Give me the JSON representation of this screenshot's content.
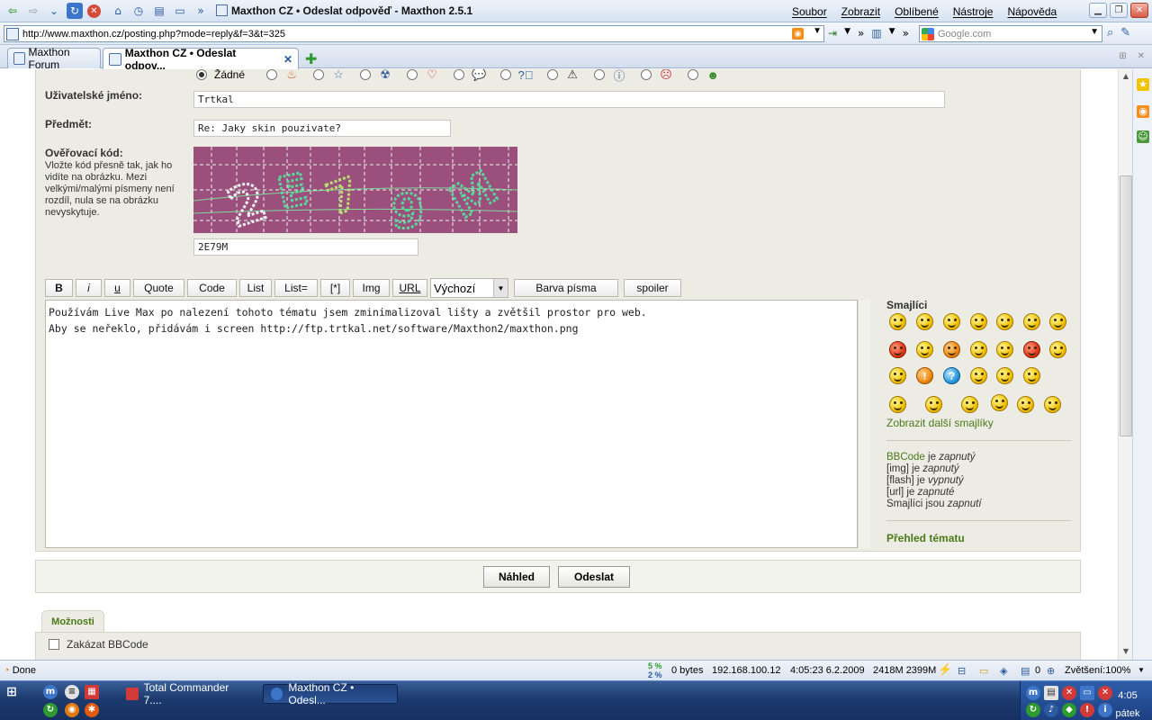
{
  "window": {
    "title": "Maxthon CZ • Odeslat odpověď - Maxthon 2.5.1",
    "menu": [
      "Soubor",
      "Zobrazit",
      "Oblíbené",
      "Nástroje",
      "Nápověda"
    ]
  },
  "address": {
    "url": "http://www.maxthon.cz/posting.php?mode=reply&f=3&t=325",
    "search_placeholder": "Google.com"
  },
  "tabs": [
    {
      "label": "Maxthon Forum"
    },
    {
      "label": "Maxthon CZ • Odeslat odpov..."
    }
  ],
  "form": {
    "icon_none_label": "Žádné",
    "username_label": "Uživatelské jméno:",
    "username_value": "Trtkal",
    "subject_label": "Předmět:",
    "subject_value": "Re: Jaky skin pouzivate?",
    "captcha_label": "Ověřovací kód:",
    "captcha_help": "Vložte kód přesně tak, jak ho vidíte na obrázku. Mezi velkými/malými písmeny není rozdíl, nula se na obrázku nevyskytuje.",
    "captcha_text": "2E79M",
    "captcha_value": "2E79M"
  },
  "toolbar": {
    "bold": "B",
    "italic": "i",
    "underline": "u",
    "quote": "Quote",
    "code": "Code",
    "list": "List",
    "list_eq": "List=",
    "list_item": "[*]",
    "img": "Img",
    "url": "URL",
    "size_select": "Výchozí",
    "font_color": "Barva písma",
    "spoiler": "spoiler"
  },
  "editor": {
    "line1": "Používám Live Max po nalezení tohoto tématu jsem zminimalizoval lišty a zvětšil prostor pro web.",
    "line2": "Aby se neřeklo, přidávám i screen http://ftp.trtkal.net/software/Maxthon2/maxthon.png"
  },
  "sidebar": {
    "smilies_title": "Smajlíci",
    "more_smilies": "Zobrazit další smajlíky",
    "bbcode_k": "BBCode",
    "bbcode_v": "zapnutý",
    "img_k": "[img]",
    "img_v": "zapnutý",
    "flash_k": "[flash]",
    "flash_v": "vypnutý",
    "url_k": "[url]",
    "url_v": "zapnuté",
    "smilies_k": "Smajlíci jsou",
    "smilies_v": "zapnutí",
    "je": "je",
    "topic_review": "Přehled tématu"
  },
  "actions": {
    "preview": "Náhled",
    "submit": "Odeslat"
  },
  "options": {
    "tab": "Možnosti",
    "disable_bbcode": "Zakázat BBCode"
  },
  "status": {
    "done": "Done",
    "pct_top": "5 %",
    "pct_bottom": "2 %",
    "bytes": "0 bytes",
    "ip": "192.168.100.12",
    "time": "4:05:23 6.2.2009",
    "mem": "2418M 2399M",
    "count": "0",
    "zoom": "Zvětšení:100%"
  },
  "taskbar": {
    "items": [
      "Total Commander 7....",
      "Maxthon CZ • Odesl..."
    ],
    "clock_time": "4:05",
    "clock_day": "pátek"
  }
}
